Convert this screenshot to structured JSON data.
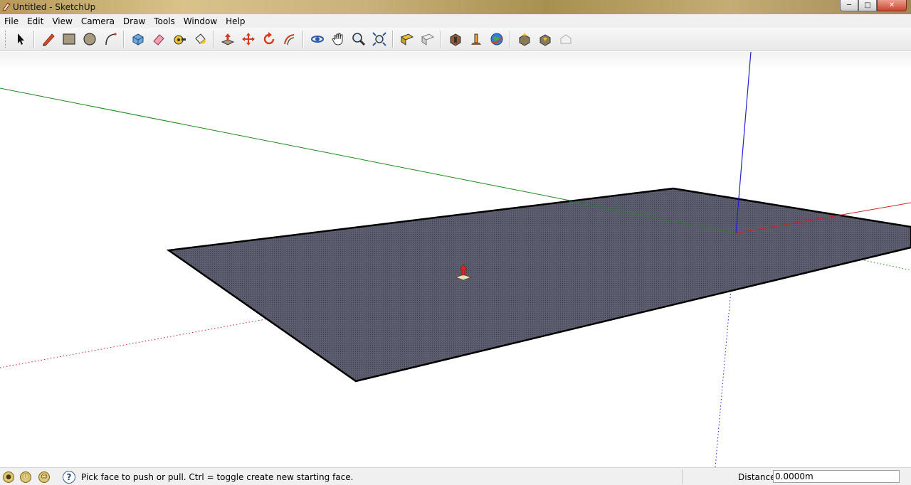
{
  "window": {
    "title": "Untitled - SketchUp",
    "controls": {
      "minimize": "─",
      "maximize": "□",
      "close": "✕"
    }
  },
  "menubar": {
    "items": [
      "File",
      "Edit",
      "View",
      "Camera",
      "Draw",
      "Tools",
      "Window",
      "Help"
    ]
  },
  "toolbar": {
    "tools": [
      "select-icon",
      "pencil-icon",
      "rectangle-icon",
      "circle-icon",
      "arc-icon",
      "make-component-icon",
      "eraser-icon",
      "tape-measure-icon",
      "paint-bucket-icon",
      "push-pull-icon",
      "move-icon",
      "rotate-icon",
      "follow-me-icon",
      "orbit-icon",
      "pan-icon",
      "zoom-icon",
      "zoom-extents-icon",
      "add-location-icon",
      "toggle-terrain-icon",
      "get-models-icon",
      "share-model-icon",
      "google-earth-icon",
      "get-components-icon",
      "share-component-icon",
      "warehouse-icon"
    ]
  },
  "colors": {
    "face": "#5c5d6e",
    "edge": "#000000",
    "axis_red": "#cc2222",
    "axis_green": "#1a8a1a",
    "axis_blue": "#2222cc"
  },
  "statusbar": {
    "message": "Pick face to push or pull.  Ctrl = toggle create new starting face.",
    "help": "?",
    "vcb_label": "Distance",
    "vcb_value": "0.0000m"
  }
}
